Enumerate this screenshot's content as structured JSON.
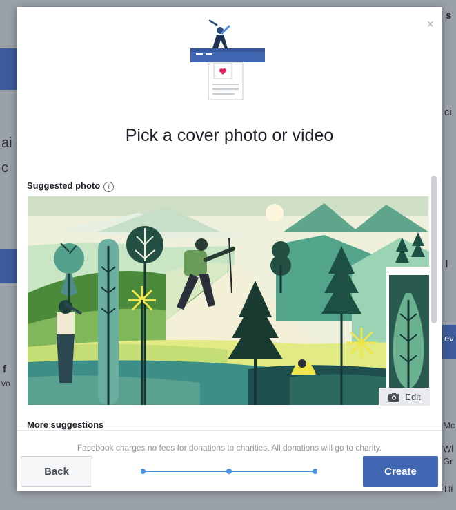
{
  "modal": {
    "title": "Pick a cover photo or video",
    "suggested_label": "Suggested photo",
    "info_glyph": "i",
    "edit_label": "Edit",
    "more_label": "More suggestions",
    "notice": "Facebook charges no fees for donations to charities. All donations will go to charity.",
    "back_label": "Back",
    "create_label": "Create",
    "close_glyph": "×",
    "progress_steps": 3
  },
  "background_fragments": {
    "top_right": "s",
    "left_1": "ai",
    "left_2": "c",
    "right_1": "ci",
    "right_2": "l",
    "left_3": "f",
    "left_4": "vo",
    "right_3": "Mc",
    "right_4": "Wl",
    "right_5": "Gr",
    "right_6": "Hi",
    "right_blue": "ev"
  },
  "colors": {
    "accent": "#4267b2",
    "progress": "#4a90e2",
    "overlay": "#9aa0a8"
  }
}
